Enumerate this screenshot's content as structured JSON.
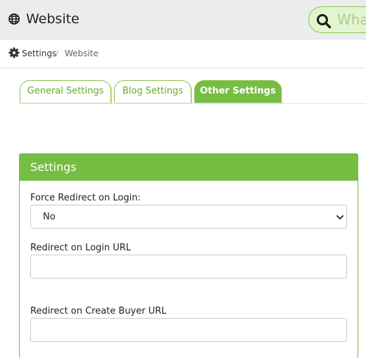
{
  "header": {
    "title": "Website",
    "icon": "globe-icon",
    "search": {
      "placeholder": "What",
      "icon": "search-icon"
    }
  },
  "breadcrumb": {
    "items": [
      "Settings",
      "Website"
    ],
    "separator": "/",
    "icon": "gear-icon"
  },
  "tabs": [
    {
      "label": "General Settings",
      "active": false
    },
    {
      "label": "Blog Settings",
      "active": false
    },
    {
      "label": "Other Settings",
      "active": true
    }
  ],
  "panel": {
    "title": "Settings",
    "fields": [
      {
        "label": "Force Redirect on Login:",
        "type": "select",
        "value": "No"
      },
      {
        "label": "Redirect on Login URL",
        "type": "text",
        "value": ""
      },
      {
        "label": "Redirect on Create Buyer URL",
        "type": "text",
        "value": ""
      }
    ]
  },
  "colors": {
    "accent": "#76bd43",
    "accent_light": "#e3f4d1",
    "topbar_bg": "#ebecee"
  }
}
